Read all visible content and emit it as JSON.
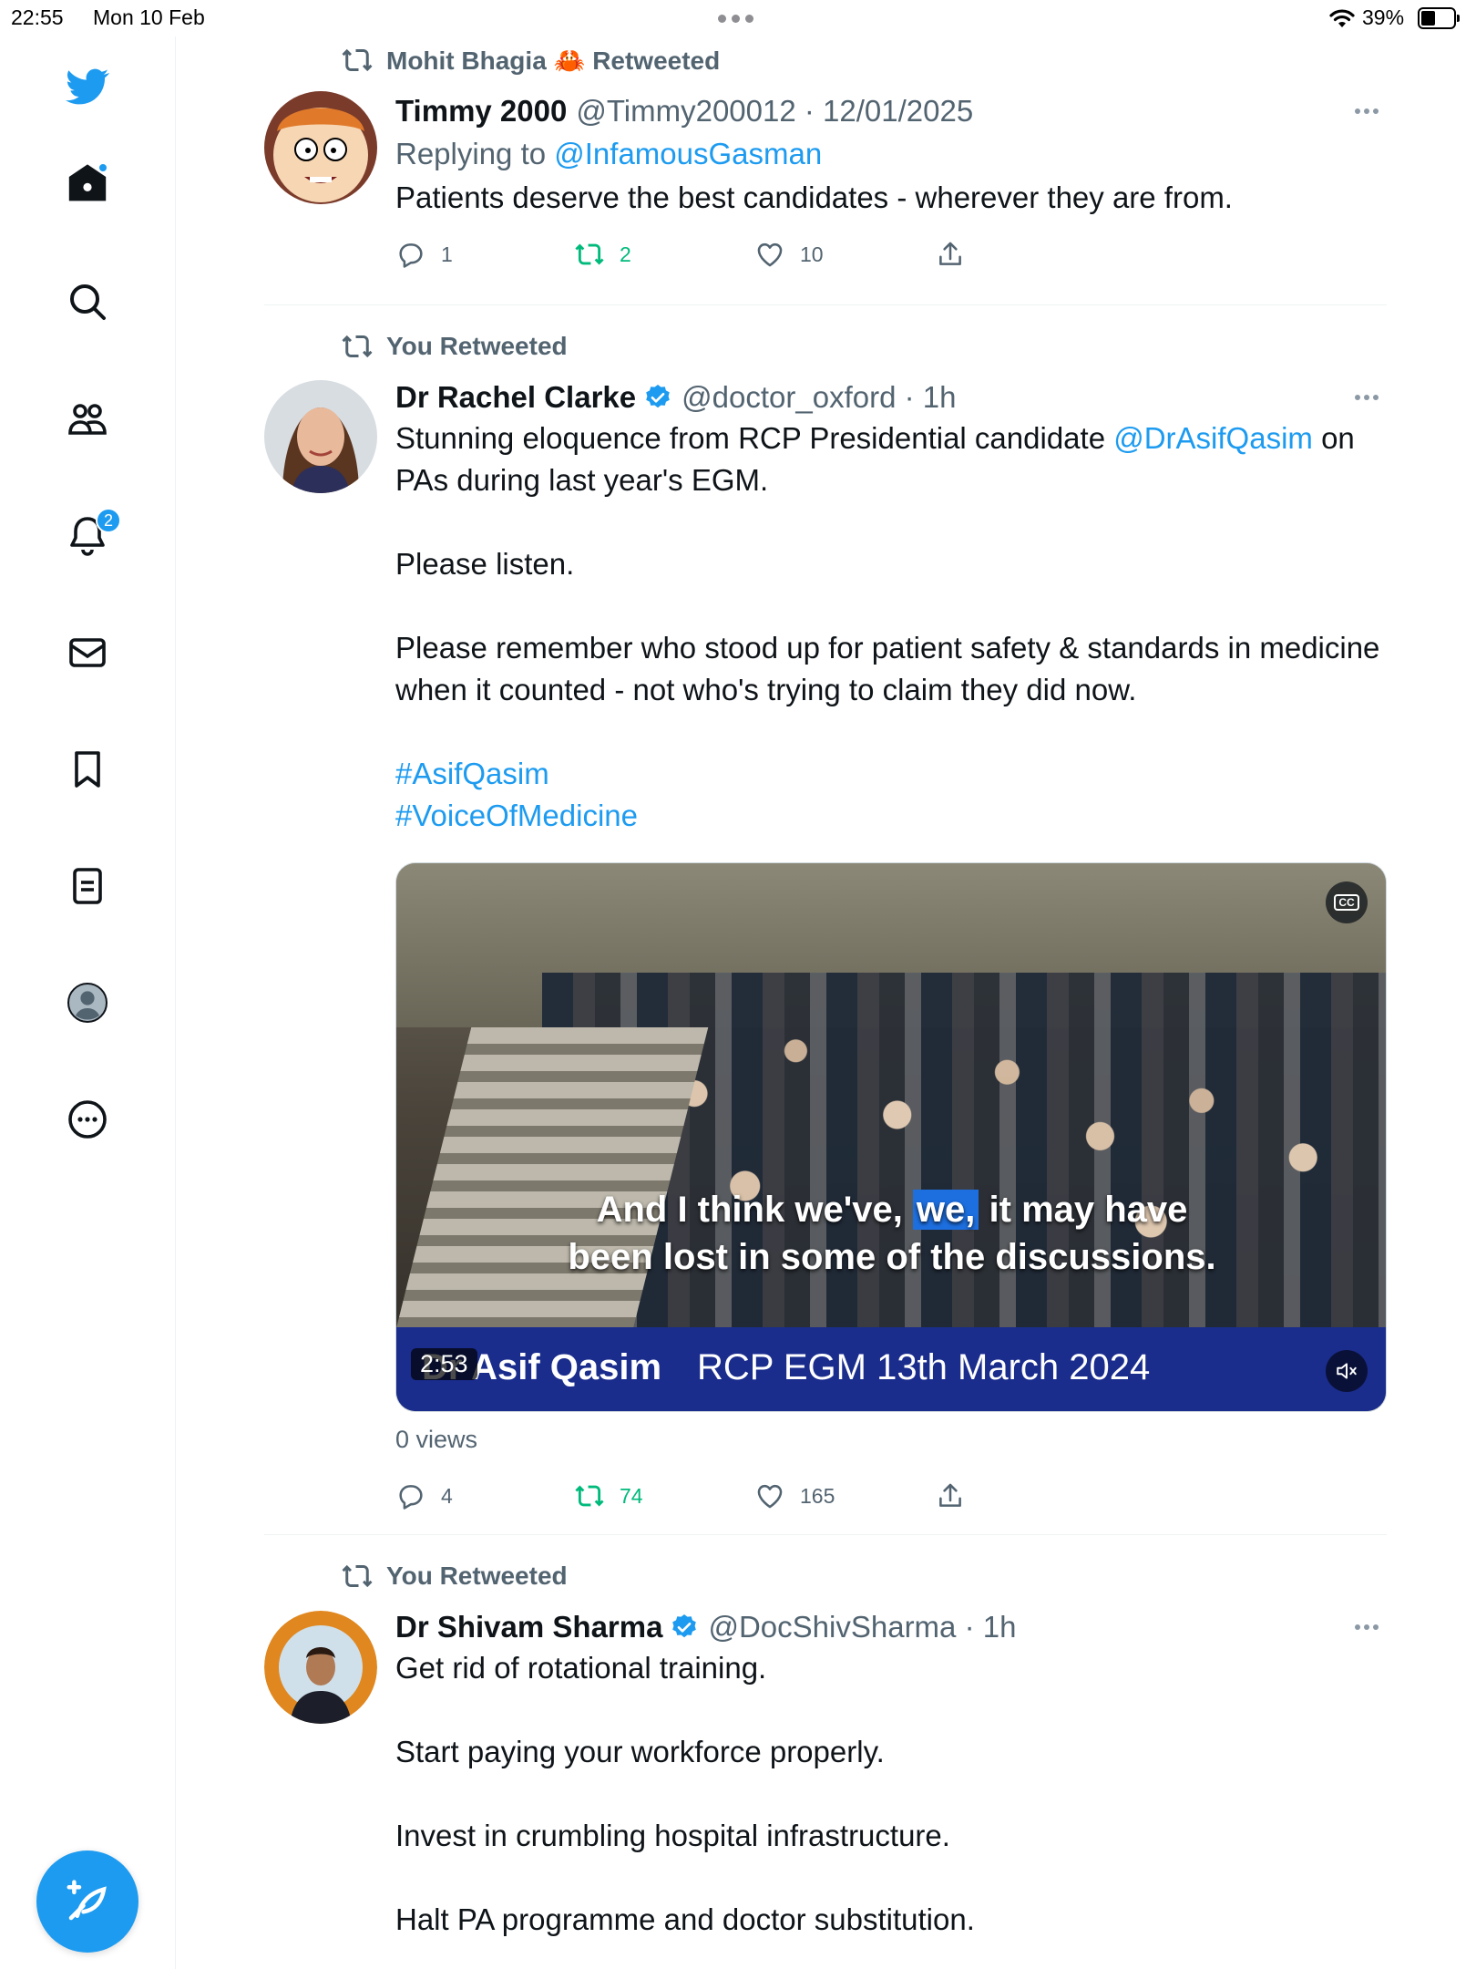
{
  "status_bar": {
    "time": "22:55",
    "date": "Mon 10 Feb",
    "battery": "39%"
  },
  "sidebar": {
    "notifications_badge": "2"
  },
  "tweets": [
    {
      "retweet_label": "Mohit Bhagia 🦀 Retweeted",
      "name": "Timmy 2000",
      "handle": "@Timmy200012 · 12/01/2025",
      "replying_prefix": "Replying to ",
      "replying_to": "@InfamousGasman",
      "text": "Patients deserve the best candidates - wherever they are from.",
      "replies": "1",
      "retweets": "2",
      "likes": "10"
    },
    {
      "retweet_label": "You Retweeted",
      "name": "Dr Rachel Clarke",
      "handle": "@doctor_oxford · 1h",
      "line1_a": "Stunning eloquence from RCP Presidential candidate ",
      "line1_mention": "@DrAsifQasim",
      "line1_b": " on PAs during last year's EGM.",
      "para2": "Please listen.",
      "para3": "Please remember who stood up for patient safety & standards in medicine when it counted - not who's trying to claim they did now.",
      "hashtag1": "#AsifQasim",
      "hashtag2": "#VoiceOfMedicine",
      "video": {
        "subtitle_a": "And I think we've, ",
        "subtitle_hl": "we,",
        "subtitle_b": " it may have",
        "subtitle_line2": "been lost in some of the discussions.",
        "lower_third_name": "Dr Asif Qasim",
        "lower_third_event": "RCP EGM 13th March 2024",
        "duration": "2:53"
      },
      "views": "0 views",
      "replies": "4",
      "retweets": "74",
      "likes": "165"
    },
    {
      "retweet_label": "You Retweeted",
      "name": "Dr Shivam Sharma",
      "handle": "@DocShivSharma · 1h",
      "para1": "Get rid of rotational training.",
      "para2": "Start paying your workforce properly.",
      "para3": "Invest in crumbling hospital infrastructure.",
      "para4": "Halt PA programme and doctor substitution."
    }
  ],
  "colors": {
    "accent": "#1d9bf0",
    "retweet_green": "#00ba7c",
    "secondary_text": "#536471"
  },
  "icons": [
    "twitter-logo-icon",
    "home-icon",
    "search-icon",
    "communities-icon",
    "notifications-icon",
    "messages-icon",
    "bookmarks-icon",
    "lists-icon",
    "profile-icon",
    "more-icon",
    "compose-icon",
    "retweet-icon",
    "reply-icon",
    "like-icon",
    "share-icon",
    "verified-icon",
    "captions-icon",
    "mute-icon"
  ]
}
